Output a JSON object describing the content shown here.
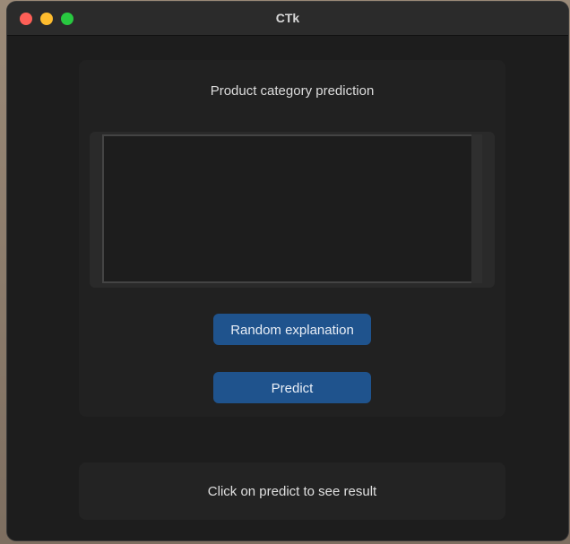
{
  "window": {
    "title": "CTk"
  },
  "main": {
    "heading": "Product category prediction",
    "textbox": {
      "value": "",
      "placeholder": ""
    },
    "random_button_label": "Random explanation",
    "predict_button_label": "Predict"
  },
  "result": {
    "text": "Click on predict to see result"
  },
  "colors": {
    "button_accent": "#1f538d",
    "window_background": "#1d1d1d",
    "frame_background": "#212121",
    "close": "#fe5f57",
    "minimize": "#febc2e",
    "zoom": "#28c840"
  }
}
